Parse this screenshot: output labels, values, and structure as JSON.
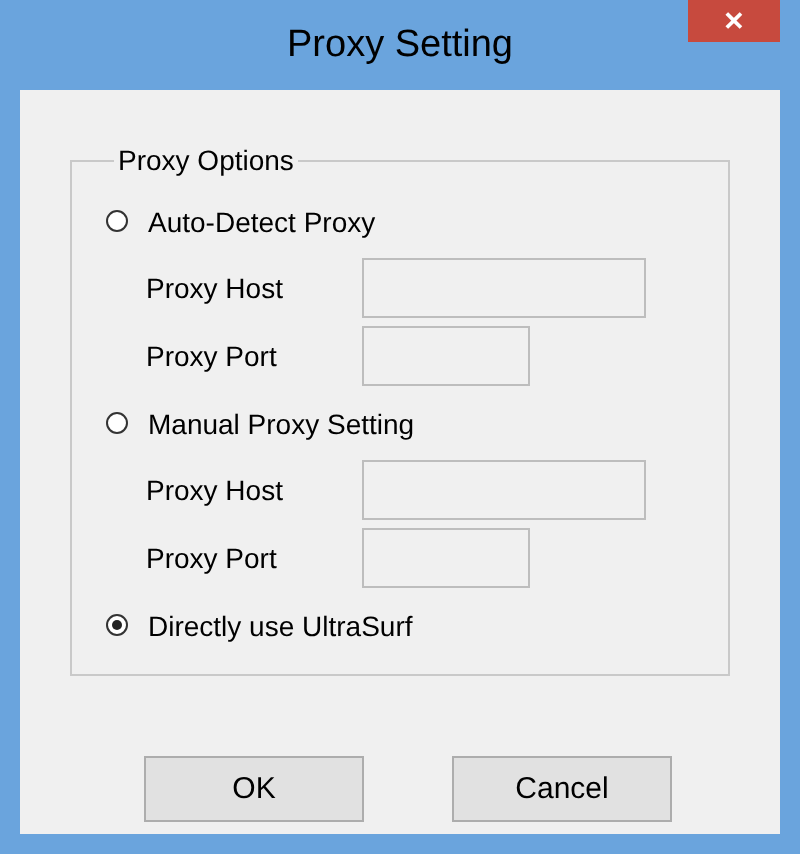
{
  "window": {
    "title": "Proxy Setting",
    "close": "✕"
  },
  "group": {
    "title": "Proxy Options",
    "options": [
      {
        "label": "Auto-Detect Proxy",
        "selected": false,
        "fields": [
          {
            "label": "Proxy Host",
            "kind": "host",
            "disabled": true
          },
          {
            "label": "Proxy Port",
            "kind": "port",
            "disabled": true
          }
        ]
      },
      {
        "label": "Manual Proxy Setting",
        "selected": false,
        "fields": [
          {
            "label": "Proxy Host",
            "kind": "host",
            "disabled": true
          },
          {
            "label": "Proxy Port",
            "kind": "port",
            "disabled": true
          }
        ]
      },
      {
        "label": "Directly use UltraSurf",
        "selected": true
      }
    ]
  },
  "buttons": [
    "OK",
    "Cancel"
  ]
}
